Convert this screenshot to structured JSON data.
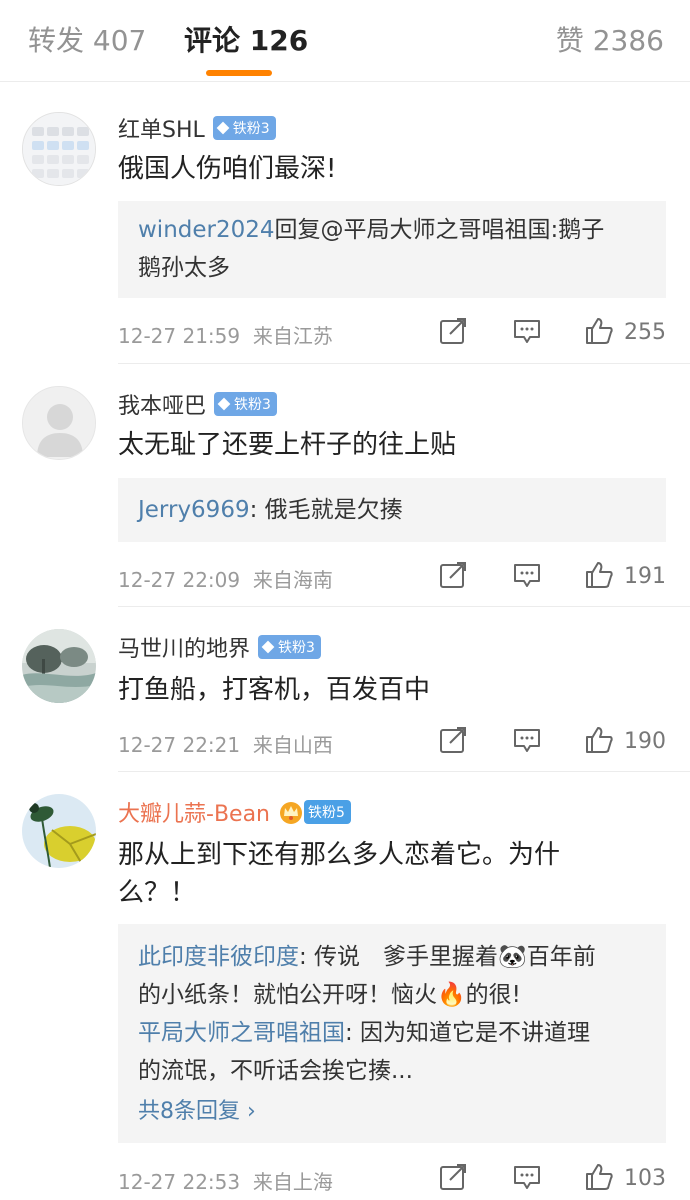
{
  "tabs": {
    "reposts": "转发 407",
    "comments": "评论 126",
    "likes": "赞 2386"
  },
  "comments": [
    {
      "username": "红单SHL",
      "badge": "铁粉3",
      "text": "俄国人伤咱们最深!",
      "replies": [
        {
          "who": "winder2024",
          "body": "回复@平局大师之哥唱祖国:鹅子",
          "body2": "鹅孙太多"
        }
      ],
      "time": "12-27 21:59",
      "location": "来自江苏",
      "likes": "255"
    },
    {
      "username": "我本哑巴",
      "badge": "铁粉3",
      "text": "太无耻了还要上杆子的往上贴",
      "replies": [
        {
          "who": "Jerry6969",
          "body": ": 俄毛就是欠揍"
        }
      ],
      "time": "12-27 22:09",
      "location": "来自海南",
      "likes": "191"
    },
    {
      "username": "马世川的地界",
      "badge": "铁粉3",
      "text": "打鱼船，打客机，百发百中",
      "time": "12-27 22:21",
      "location": "来自山西",
      "likes": "190"
    },
    {
      "username": "大瓣儿蒜-Bean",
      "badge": "铁粉5",
      "text_line1": "那从上到下还有那么多人恋着它。为什",
      "text_line2": "么？！",
      "replies": [
        {
          "who": "此印度非彼印度",
          "body": ": 传说　爹手里握着",
          "emoji1": "🐼",
          "body_cont": "百年前",
          "line2": "的小纸条！就怕公开呀！恼火",
          "emoji2": "🔥",
          "line2_end": "的很!"
        },
        {
          "who": "平局大师之哥唱祖国",
          "body": ": 因为知道它是不讲道理",
          "line2": "的流氓，不听话会挨它揍..."
        }
      ],
      "more_replies": "共8条回复 ›",
      "time": "12-27 22:53",
      "location": "来自上海",
      "likes": "103"
    }
  ]
}
